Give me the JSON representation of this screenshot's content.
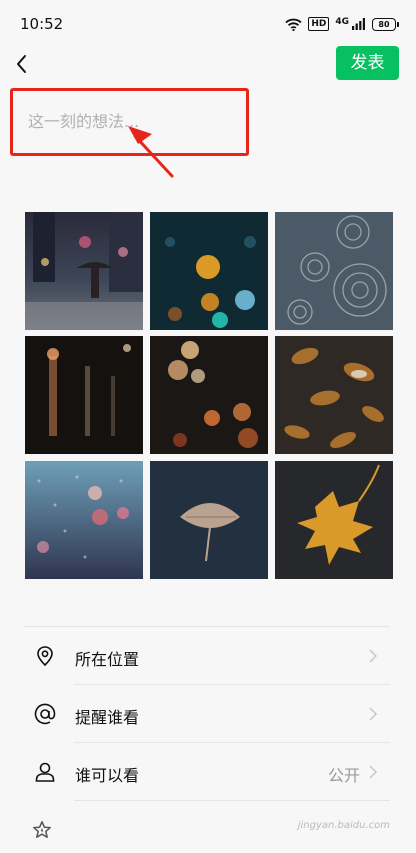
{
  "status_bar": {
    "time": "10:52",
    "hd": "HD",
    "network": "4G",
    "battery": "80"
  },
  "header": {
    "post_label": "发表"
  },
  "composer": {
    "placeholder": "这一刻的想法..."
  },
  "photos": [
    {
      "subject": "night city street in rain with umbrella"
    },
    {
      "subject": "colorful bokeh rain drops on glass"
    },
    {
      "subject": "rain ripples on water"
    },
    {
      "subject": "night street reflections"
    },
    {
      "subject": "warm bokeh lights at night"
    },
    {
      "subject": "wet autumn leaves on ground"
    },
    {
      "subject": "rainy window with bokeh"
    },
    {
      "subject": "single leaf on wet asphalt"
    },
    {
      "subject": "yellow maple leaf with water drops"
    }
  ],
  "menu": {
    "location_label": "所在位置",
    "remind_label": "提醒谁看",
    "visibility_label": "谁可以看",
    "visibility_value": "公开"
  },
  "watermark": "jingyan.baidu.com",
  "colors": {
    "accent": "#07c160",
    "annotation_red": "#e8251a"
  }
}
